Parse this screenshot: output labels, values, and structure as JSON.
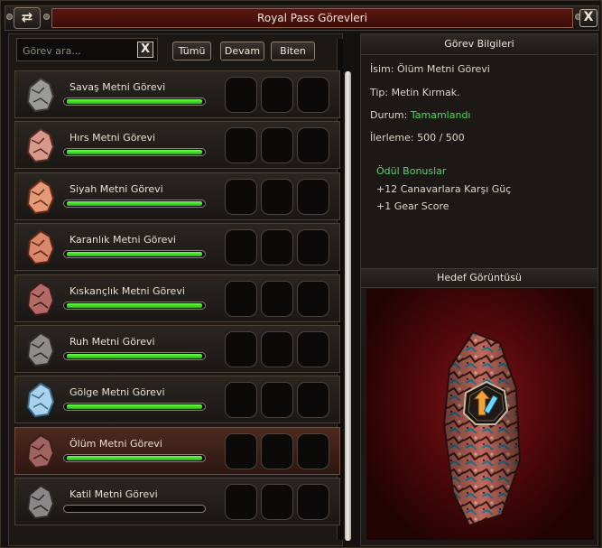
{
  "window": {
    "title": "Royal Pass Görevleri",
    "refresh_icon": "refresh-icon",
    "close_label": "X"
  },
  "search": {
    "placeholder": "Görev ara...",
    "clear_label": "X"
  },
  "filters": [
    {
      "label": "Tümü"
    },
    {
      "label": "Devam"
    },
    {
      "label": "Biten"
    }
  ],
  "quests": [
    {
      "name": "Savaş Metni Görevi",
      "progress": 1.0,
      "stone": "#9a9a96",
      "stone_dark": "#3c3c3a",
      "selected": false
    },
    {
      "name": "Hırs Metni Görevi",
      "progress": 1.0,
      "stone": "#d79a8a",
      "stone_dark": "#5a2a24",
      "selected": false
    },
    {
      "name": "Siyah Metni Görevi",
      "progress": 1.0,
      "stone": "#e59a76",
      "stone_dark": "#6a2a18",
      "selected": false
    },
    {
      "name": "Karanlık Metni Görevi",
      "progress": 1.0,
      "stone": "#d9886c",
      "stone_dark": "#5c2416",
      "selected": false
    },
    {
      "name": "Kıskançlık Metni Görevi",
      "progress": 1.0,
      "stone": "#b26a66",
      "stone_dark": "#3f1a1a",
      "selected": false
    },
    {
      "name": "Ruh Metni Görevi",
      "progress": 1.0,
      "stone": "#8e8c8a",
      "stone_dark": "#2e2d2c",
      "selected": false
    },
    {
      "name": "Gölge Metni Görevi",
      "progress": 1.0,
      "stone": "#a9d2ec",
      "stone_dark": "#3a6a8a",
      "selected": false
    },
    {
      "name": "Ölüm Metni Görevi",
      "progress": 1.0,
      "stone": "#a0645e",
      "stone_dark": "#3a1c1a",
      "selected": true
    },
    {
      "name": "Katil Metni Görevi",
      "progress": 0.0,
      "stone": "#8a8886",
      "stone_dark": "#2b2a29",
      "selected": false
    }
  ],
  "details": {
    "header": "Görev Bilgileri",
    "name_line": "İsim: Ölüm Metni Görevi",
    "type_line": "Tip: Metin Kırmak.",
    "status_label": "Durum:",
    "status_value": "Tamamlandı",
    "progress_line": "İlerleme: 500 / 500",
    "bonus_title": "Ödül Bonuslar",
    "bonuses": [
      "+12 Canavarlara Karşı Güç",
      "+1 Gear Score"
    ],
    "status_color": "#46e04a"
  },
  "preview": {
    "header": "Hedef Görüntüsü",
    "badge_icon": "upgrade-arrow-icon"
  },
  "colors": {
    "accent_red": "#5a1710",
    "progress_green": "#3fd926"
  }
}
